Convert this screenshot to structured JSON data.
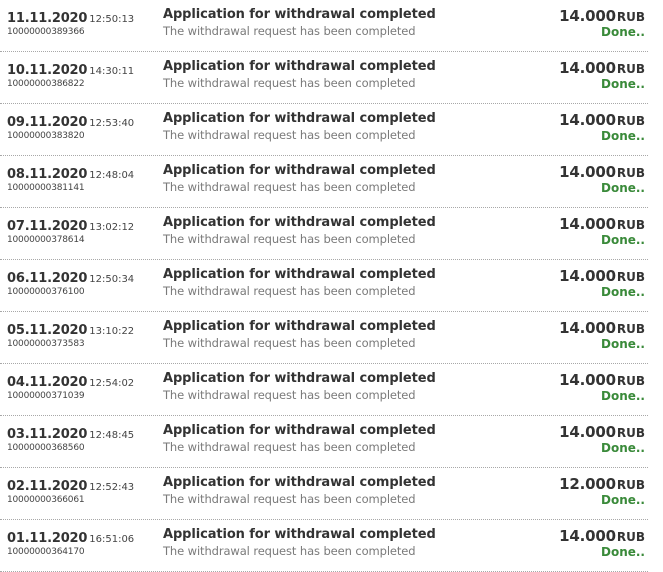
{
  "transactions": [
    {
      "date": "11.11.2020",
      "time": "12:50:13",
      "id": "10000000389366",
      "title": "Application for withdrawal completed",
      "description": "The withdrawal request has been completed",
      "amount": "14.000",
      "currency": "RUB",
      "status": "Done.."
    },
    {
      "date": "10.11.2020",
      "time": "14:30:11",
      "id": "10000000386822",
      "title": "Application for withdrawal completed",
      "description": "The withdrawal request has been completed",
      "amount": "14.000",
      "currency": "RUB",
      "status": "Done.."
    },
    {
      "date": "09.11.2020",
      "time": "12:53:40",
      "id": "10000000383820",
      "title": "Application for withdrawal completed",
      "description": "The withdrawal request has been completed",
      "amount": "14.000",
      "currency": "RUB",
      "status": "Done.."
    },
    {
      "date": "08.11.2020",
      "time": "12:48:04",
      "id": "10000000381141",
      "title": "Application for withdrawal completed",
      "description": "The withdrawal request has been completed",
      "amount": "14.000",
      "currency": "RUB",
      "status": "Done.."
    },
    {
      "date": "07.11.2020",
      "time": "13:02:12",
      "id": "10000000378614",
      "title": "Application for withdrawal completed",
      "description": "The withdrawal request has been completed",
      "amount": "14.000",
      "currency": "RUB",
      "status": "Done.."
    },
    {
      "date": "06.11.2020",
      "time": "12:50:34",
      "id": "10000000376100",
      "title": "Application for withdrawal completed",
      "description": "The withdrawal request has been completed",
      "amount": "14.000",
      "currency": "RUB",
      "status": "Done.."
    },
    {
      "date": "05.11.2020",
      "time": "13:10:22",
      "id": "10000000373583",
      "title": "Application for withdrawal completed",
      "description": "The withdrawal request has been completed",
      "amount": "14.000",
      "currency": "RUB",
      "status": "Done.."
    },
    {
      "date": "04.11.2020",
      "time": "12:54:02",
      "id": "10000000371039",
      "title": "Application for withdrawal completed",
      "description": "The withdrawal request has been completed",
      "amount": "14.000",
      "currency": "RUB",
      "status": "Done.."
    },
    {
      "date": "03.11.2020",
      "time": "12:48:45",
      "id": "10000000368560",
      "title": "Application for withdrawal completed",
      "description": "The withdrawal request has been completed",
      "amount": "14.000",
      "currency": "RUB",
      "status": "Done.."
    },
    {
      "date": "02.11.2020",
      "time": "12:52:43",
      "id": "10000000366061",
      "title": "Application for withdrawal completed",
      "description": "The withdrawal request has been completed",
      "amount": "12.000",
      "currency": "RUB",
      "status": "Done.."
    },
    {
      "date": "01.11.2020",
      "time": "16:51:06",
      "id": "10000000364170",
      "title": "Application for withdrawal completed",
      "description": "The withdrawal request has been completed",
      "amount": "14.000",
      "currency": "RUB",
      "status": "Done.."
    }
  ],
  "colors": {
    "status_done": "#3a8a3a",
    "text_primary": "#333333",
    "text_secondary": "#7a7a7a"
  }
}
